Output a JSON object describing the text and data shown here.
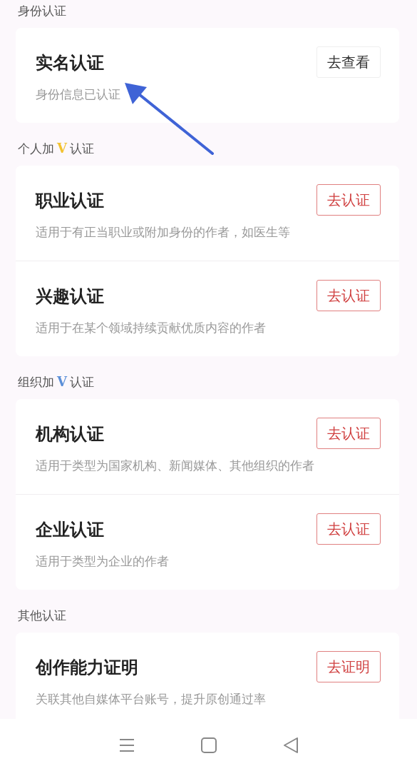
{
  "sections": [
    {
      "title": "身份认证",
      "items": [
        {
          "title": "实名认证",
          "description": "身份信息已认证",
          "button": {
            "label": "去查看",
            "kind": "view"
          }
        }
      ]
    },
    {
      "title": "个人加",
      "badge": {
        "label": "V",
        "color": "#f2c230"
      },
      "title_suffix": "认证",
      "items": [
        {
          "title": "职业认证",
          "description": "适用于有正当职业或附加身份的作者，如医生等",
          "button": {
            "label": "去认证",
            "kind": "action"
          }
        },
        {
          "title": "兴趣认证",
          "description": "适用于在某个领域持续贡献优质内容的作者",
          "button": {
            "label": "去认证",
            "kind": "action"
          }
        }
      ]
    },
    {
      "title": "组织加",
      "badge": {
        "label": "V",
        "color": "#5b8fd8"
      },
      "title_suffix": "认证",
      "items": [
        {
          "title": "机构认证",
          "description": "适用于类型为国家机构、新闻媒体、其他组织的作者",
          "button": {
            "label": "去认证",
            "kind": "action"
          }
        },
        {
          "title": "企业认证",
          "description": "适用于类型为企业的作者",
          "button": {
            "label": "去认证",
            "kind": "action"
          }
        }
      ]
    },
    {
      "title": "其他认证",
      "items": [
        {
          "title": "创作能力证明",
          "description": "关联其他自媒体平台账号，提升原创通过率",
          "button": {
            "label": "去证明",
            "kind": "action"
          }
        }
      ]
    }
  ],
  "annotation": {
    "kind": "arrow"
  }
}
